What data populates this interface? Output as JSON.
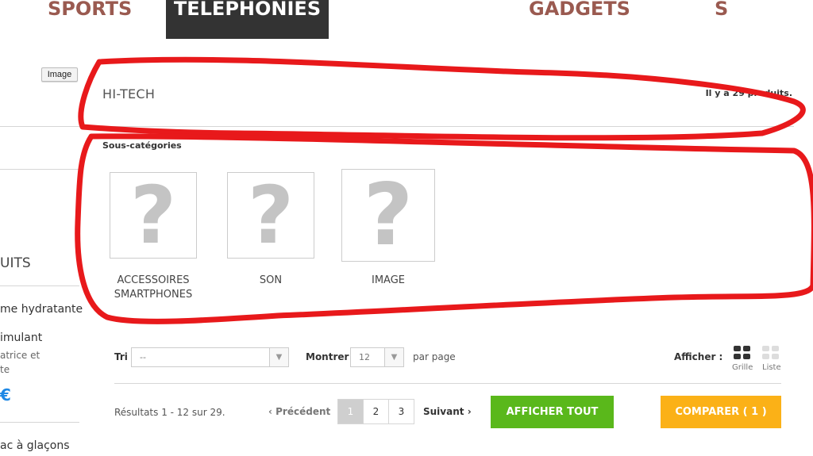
{
  "nav": {
    "items": [
      "SPORTS",
      "TELEPHONIES",
      "GADGETS",
      "s"
    ],
    "active": "TELEPHONIES"
  },
  "sidebar": {
    "image_button": "Image",
    "section_title_fragment": "UITS",
    "lines": [
      "me hydratante",
      "imulant",
      "atrice et",
      "te"
    ],
    "price_fragment": "€",
    "bottom_line": "ac à glaçons"
  },
  "category": {
    "title": "HI-TECH",
    "count": "Il y a 29 produits.",
    "subcategories_heading": "Sous-catégories",
    "subcategories": [
      {
        "label": "ACCESSOIRES SMARTPHONES",
        "icon": "placeholder-question-icon"
      },
      {
        "label": "SON",
        "icon": "placeholder-question-icon"
      },
      {
        "label": "IMAGE",
        "icon": "placeholder-question-icon"
      }
    ],
    "placeholder_glyph": "?"
  },
  "toolbar": {
    "sort_label": "Tri",
    "sort_value": "--",
    "show_label": "Montrer",
    "show_value": "12",
    "per_page": "par page",
    "view_label": "Afficher :",
    "view_grid": "Grille",
    "view_list": "Liste"
  },
  "pagination": {
    "results": "Résultats 1 - 12 sur 29.",
    "previous": "Précédent",
    "next": "Suivant",
    "pages": [
      "1",
      "2",
      "3"
    ],
    "current_page": "1"
  },
  "buttons": {
    "show_all": "AFFICHER TOUT",
    "compare": "COMPARER ( 1 )"
  },
  "colors": {
    "nav_text": "#9a5a50",
    "nav_active_bg": "#333333",
    "annotation": "#e8191b",
    "show_all": "#5ab81b",
    "compare": "#fbb117",
    "price": "#1e88e5"
  }
}
